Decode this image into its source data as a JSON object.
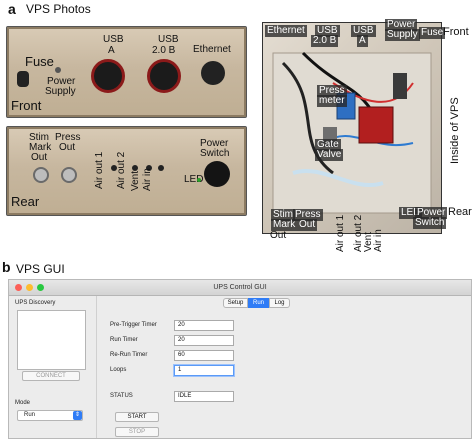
{
  "panel_a": {
    "letter": "a",
    "title": "VPS Photos",
    "front": {
      "name": "Front",
      "labels": {
        "fuse": "Fuse",
        "power_supply_1": "Power",
        "power_supply_2": "Supply",
        "usb_a_1": "USB",
        "usb_a_2": "A",
        "usb_b_1": "USB",
        "usb_b_2": "2.0 B",
        "ethernet": "Ethernet"
      }
    },
    "rear": {
      "name": "Rear",
      "labels": {
        "stim_1": "Stim",
        "stim_2": "Mark",
        "stim_3": "Out",
        "press_1": "Press",
        "press_2": "Out",
        "air_out_1": "Air out 1",
        "air_out_2": "Air out 2",
        "vent": "Vent",
        "air_in": "Air in",
        "power_switch_1": "Power",
        "power_switch_2": "Switch",
        "led": "LED"
      }
    },
    "inside": {
      "side_label": "Inside of VPS",
      "front_label": "Front",
      "rear_label": "Rear",
      "labels": {
        "ethernet": "Ethernet",
        "usb_b_1": "USB",
        "usb_b_2": "2.0 B",
        "usb_a_1": "USB",
        "usb_a_2": "A",
        "power_supply_1": "Power",
        "power_supply_2": "Supply",
        "fuse": "Fuse",
        "press_meter_1": "Press",
        "press_meter_2": "meter",
        "gate_valve_1": "Gate",
        "gate_valve_2": "Valve",
        "stim_1": "Stim",
        "stim_2": "Mark",
        "stim_3": "Out",
        "press_1": "Press",
        "press_2": "Out",
        "air_out_1": "Air out 1",
        "air_out_2": "Air out 2",
        "vent": "Vent",
        "air_in": "Air in",
        "led": "LED",
        "power_1": "Power",
        "power_2": "Switch"
      }
    }
  },
  "panel_b": {
    "letter": "b",
    "title": "VPS GUI",
    "window_title": "UPS Control GUI",
    "discovery_label": "UPS Discovery",
    "connect_label": "CONNECT",
    "mode_label": "Mode",
    "mode_value": "Run",
    "tabs": [
      "Setup",
      "Run",
      "Log"
    ],
    "active_tab": "Run",
    "fields": [
      {
        "label": "Pre-Trigger Timer",
        "value": "20"
      },
      {
        "label": "Run Timer",
        "value": "20"
      },
      {
        "label": "Re-Run Timer",
        "value": "60"
      },
      {
        "label": "Loops",
        "value": "1"
      }
    ],
    "status_label": "STATUS",
    "status_value": "IDLE",
    "start_label": "START",
    "stop_label": "STOP",
    "colors": {
      "accent": "#2f7cf6",
      "close": "#fc5f57",
      "minimize": "#fdbc2e",
      "zoom": "#28c840"
    }
  }
}
